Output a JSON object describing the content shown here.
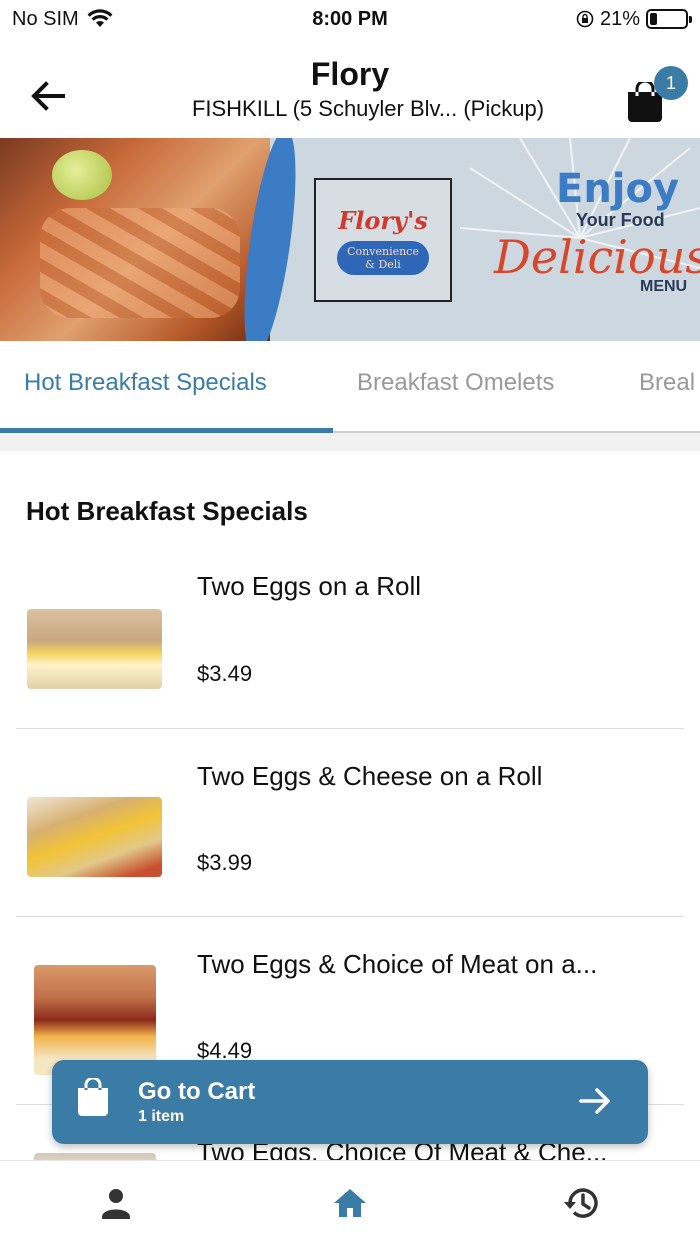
{
  "status_bar": {
    "carrier": "No SIM",
    "time": "8:00 PM",
    "battery_percent": "21%",
    "battery_level": 0.21
  },
  "header": {
    "title": "Flory",
    "subtitle": "FISHKILL (5 Schuyler Blv...  (Pickup)",
    "cart_count": "1"
  },
  "banner": {
    "logo_name": "Flory's",
    "logo_line1": "Convenience",
    "logo_line2": "& Deli",
    "enjoy": "Enjoy",
    "your_food": "Your Food",
    "delicious": "Delicious",
    "menu": "MENU"
  },
  "tabs": [
    {
      "label": "Hot Breakfast Specials",
      "active": true
    },
    {
      "label": "Breakfast Omelets",
      "active": false
    },
    {
      "label": "Breal",
      "active": false
    }
  ],
  "section": {
    "title": "Hot Breakfast Specials"
  },
  "items": [
    {
      "name": "Two Eggs on a Roll",
      "price": "$3.49"
    },
    {
      "name": "Two Eggs & Cheese on a Roll",
      "price": "$3.99"
    },
    {
      "name": "Two Eggs & Choice of Meat on a...",
      "price": "$4.49"
    },
    {
      "name": "Two Eggs, Choice Of Meat & Che...",
      "price": ""
    }
  ],
  "cart_bar": {
    "label": "Go to Cart",
    "sub": "1 item"
  },
  "bottom_nav": [
    {
      "icon": "person-icon"
    },
    {
      "icon": "home-icon"
    },
    {
      "icon": "history-icon"
    }
  ],
  "colors": {
    "accent": "#3a7ca5",
    "inactive_tab": "#999999"
  }
}
